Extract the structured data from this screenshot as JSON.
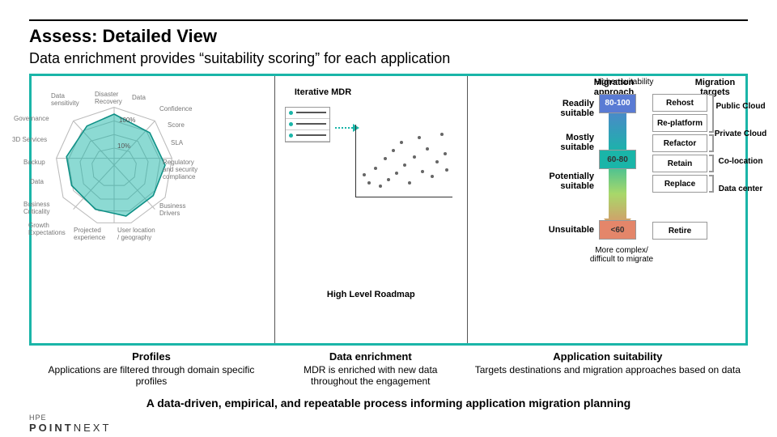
{
  "title": "Assess: Detailed View",
  "subtitle": "Data enrichment provides “suitability scoring” for each application",
  "radar_axes": [
    "Disaster Recovery",
    "Data",
    "Confidence",
    "Score",
    "SLA",
    "Regulatory and security compliance",
    "Business Drivers",
    "User location / geography",
    "Projected experience",
    "Growth Expectations",
    "Business Criticality",
    "Data",
    "Backup",
    "3D Services",
    "Governance",
    "Data sensitivity"
  ],
  "mdr_label": "Iterative MDR",
  "hlr_label": "High Level Roadmap",
  "suitability": {
    "top_note": "Higher suitability",
    "bottom_note": "More complex/ difficult to migrate",
    "header_approach": "Migration approach",
    "header_targets": "Migration targets",
    "levels": [
      {
        "label": "Readily suitable",
        "score": "80-100",
        "color": "#5a7bd4"
      },
      {
        "label": "Mostly suitable",
        "score": "60-80",
        "color": "#1ab5a8"
      },
      {
        "label": "Potentially suitable",
        "score": "",
        "color": ""
      },
      {
        "label": "Unsuitable",
        "score": "<60",
        "color": "#e4866a"
      }
    ],
    "approaches": [
      "Rehost",
      "Re-platform",
      "Refactor",
      "Retain",
      "Replace",
      "Retire"
    ],
    "targets": [
      "Public Cloud",
      "Private Cloud",
      "Co-location",
      "Data center"
    ]
  },
  "descriptions": [
    {
      "title": "Profiles",
      "text": "Applications are filtered through domain specific profiles"
    },
    {
      "title": "Data enrichment",
      "text": "MDR is enriched with new data throughout the engagement"
    },
    {
      "title": "Application suitability",
      "text": "Targets destinations and migration approaches based on data"
    }
  ],
  "footer": "A data-driven, empirical, and repeatable process informing application migration planning",
  "logo_top": "HPE",
  "logo_main": "POINTNEXT"
}
